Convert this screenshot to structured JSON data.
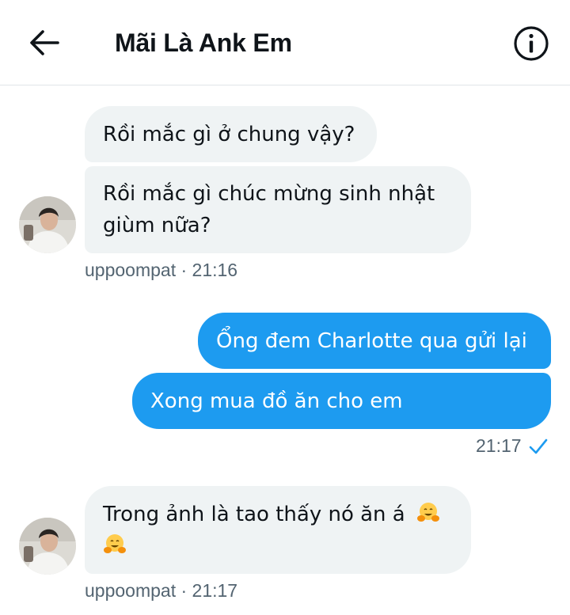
{
  "header": {
    "title": "Mãi Là Ank Em",
    "back_icon": "arrow-left-icon",
    "info_icon": "info-circle-icon"
  },
  "colors": {
    "outgoing_bubble": "#1d9bf0",
    "incoming_bubble": "#eff3f4",
    "meta_text": "#536471",
    "read_check": "#1d9bf0"
  },
  "messages": [
    {
      "direction": "in",
      "text": "Rồi mắc gì ở chung vậy?"
    },
    {
      "direction": "in",
      "text": "Rồi mắc gì chúc mừng sinh nhật giùm nữa?"
    },
    {
      "direction": "in",
      "meta": "uppoompat · 21:16"
    },
    {
      "direction": "out",
      "text": "Ổng đem Charlotte qua gửi lại"
    },
    {
      "direction": "out",
      "text": "Xong mua đồ ăn cho em"
    },
    {
      "direction": "out",
      "meta": "21:17",
      "status_icon": "read-check-icon"
    },
    {
      "direction": "in",
      "text": "Trong ảnh là tao thấy nó ăn á",
      "emoji": "hugging-face-emoji"
    },
    {
      "direction": "in",
      "meta": "uppoompat · 21:17"
    }
  ]
}
